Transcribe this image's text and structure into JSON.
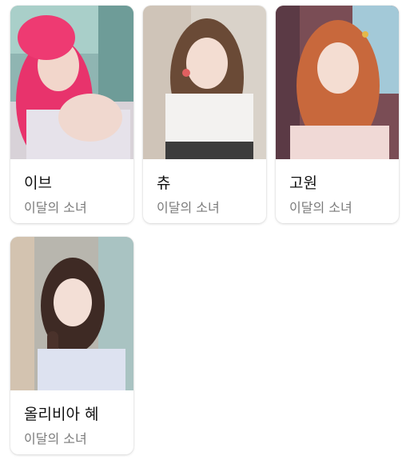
{
  "people": [
    {
      "name": "이브",
      "group": "이달의 소녀",
      "photo": "portrait-photo-pink-hair"
    },
    {
      "name": "츄",
      "group": "이달의 소녀",
      "photo": "portrait-photo-brown-hair"
    },
    {
      "name": "고원",
      "group": "이달의 소녀",
      "photo": "portrait-photo-copper-hair"
    },
    {
      "name": "올리비아 혜",
      "group": "이달의 소녀",
      "photo": "portrait-photo-dark-braid"
    }
  ]
}
